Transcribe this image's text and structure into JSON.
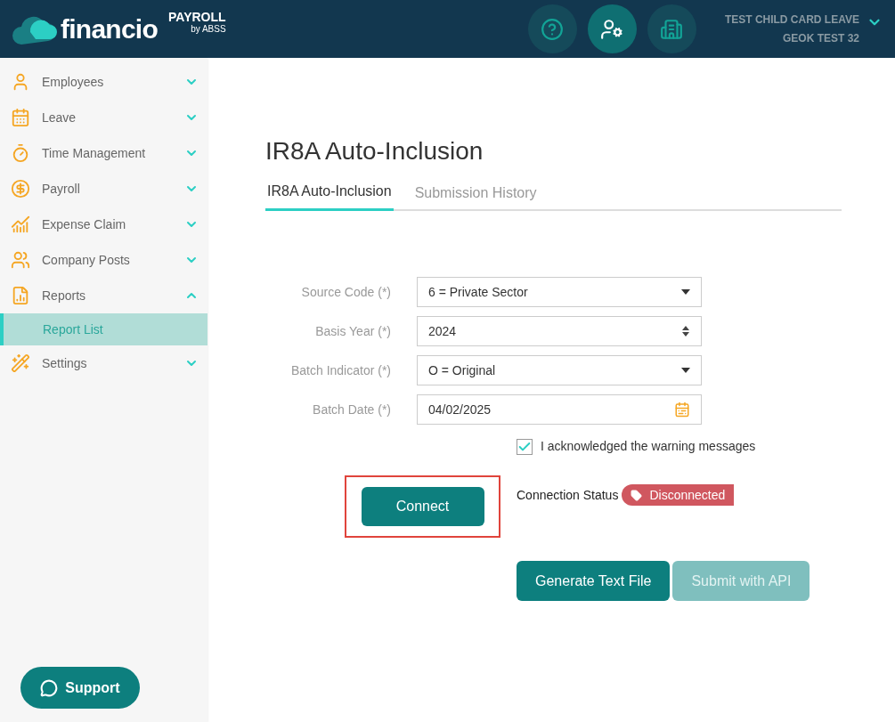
{
  "header": {
    "logo": "financio",
    "product": "PAYROLL",
    "by": "by ABSS",
    "icons": [
      {
        "kind": "help",
        "selected": false
      },
      {
        "kind": "user-settings",
        "selected": true
      },
      {
        "kind": "building",
        "selected": false
      }
    ],
    "company": "TEST CHILD CARD LEAVE",
    "user": "GEOK TEST 32"
  },
  "sidebar": {
    "items": [
      {
        "kind": "person",
        "label": "Employees",
        "expanded": false
      },
      {
        "kind": "calendar",
        "label": "Leave",
        "expanded": false
      },
      {
        "kind": "timer",
        "label": "Time Management",
        "expanded": false
      },
      {
        "kind": "moneybag",
        "label": "Payroll",
        "expanded": false
      },
      {
        "kind": "chart",
        "label": "Expense Claim",
        "expanded": false
      },
      {
        "kind": "people",
        "label": "Company Posts",
        "expanded": false
      },
      {
        "kind": "report",
        "label": "Reports",
        "expanded": true,
        "children": [
          {
            "label": "Report List",
            "selected": true
          }
        ]
      },
      {
        "kind": "wand",
        "label": "Settings",
        "expanded": false
      }
    ],
    "support": "Support"
  },
  "page": {
    "title": "IR8A Auto-Inclusion",
    "tabs": [
      {
        "label": "IR8A Auto-Inclusion",
        "selected": true
      },
      {
        "label": "Submission History",
        "selected": false
      }
    ],
    "fields": [
      {
        "kind": "select",
        "label": "Source Code (*)",
        "value": "6 = Private Sector"
      },
      {
        "kind": "number",
        "label": "Basis Year (*)",
        "value": "2024"
      },
      {
        "kind": "select",
        "label": "Batch Indicator (*)",
        "value": "O = Original"
      },
      {
        "kind": "date",
        "label": "Batch Date (*)",
        "value": "04/02/2025"
      }
    ],
    "acknowledge": {
      "label": "I acknowledged the warning messages",
      "checked": true
    },
    "connect": {
      "label": "Connect",
      "highlighted": true
    },
    "status": {
      "label": "Connection Status",
      "value": "Disconnected",
      "color": "#d0575f"
    },
    "buttons": [
      {
        "label": "Generate Text File",
        "disabled": false
      },
      {
        "label": "Submit with API",
        "disabled": true
      }
    ]
  }
}
